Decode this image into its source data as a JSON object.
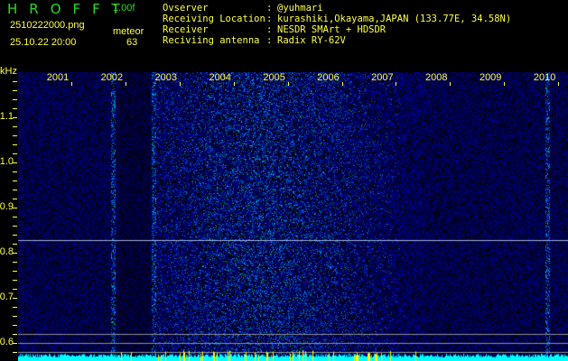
{
  "header": {
    "app_title": "HROFFT",
    "version": "1.00f",
    "filename": "2510222000.png",
    "datetime": "25.10.22 20:00",
    "count_label": "meteor",
    "count_value": "63"
  },
  "info": [
    {
      "label": "Ovserver",
      "value": "@yuhmari"
    },
    {
      "label": "Receiving Location",
      "value": "kurashiki,Okayama,JAPAN (133.77E, 34.58N)"
    },
    {
      "label": "Receiver",
      "value": "NESDR SMArt + HDSDR"
    },
    {
      "label": "Reciviing antenna",
      "value": "Radix RY-62V"
    }
  ],
  "axis": {
    "unit": "kHz",
    "freq_labels": [
      "1.1",
      "1.0",
      "0.9",
      "0.8",
      "0.7",
      "0.6"
    ],
    "freq_values": [
      1.1,
      1.0,
      0.9,
      0.8,
      0.7,
      0.6
    ],
    "freq_range": [
      0.56,
      1.2
    ],
    "time_labels": [
      "2001",
      "2002",
      "2003",
      "2004",
      "2005",
      "2006",
      "2007",
      "2008",
      "2009",
      "2010"
    ]
  },
  "colors": {
    "title": "#22dd22",
    "text": "#ffff44",
    "noise": "#1020c0",
    "histogram": "#00ffff",
    "spike": "#ffff00"
  }
}
